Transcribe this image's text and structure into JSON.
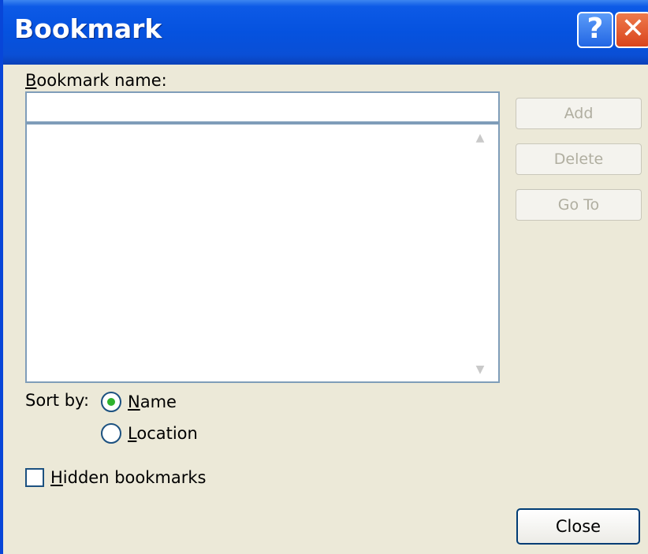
{
  "window": {
    "title": "Bookmark",
    "help_glyph": "?",
    "close_glyph": "✕"
  },
  "name_field": {
    "label_accel": "B",
    "label_rest": "ookmark name:",
    "value": ""
  },
  "list": {
    "scroll_up": "▲",
    "scroll_down": "▼"
  },
  "buttons": {
    "add": "Add",
    "delete": "Delete",
    "goto": "Go To",
    "close": "Close"
  },
  "sort": {
    "label": "Sort by:",
    "name_accel": "N",
    "name_rest": "ame",
    "location_accel": "L",
    "location_rest": "ocation",
    "selected": "Name"
  },
  "hidden": {
    "accel": "H",
    "rest": "idden bookmarks",
    "checked": false
  },
  "colors": {
    "titlebar": "#0552df",
    "dialog_bg": "#ECE9D8",
    "radio_dot": "#2eb22e",
    "close_button": "#d9441c"
  }
}
